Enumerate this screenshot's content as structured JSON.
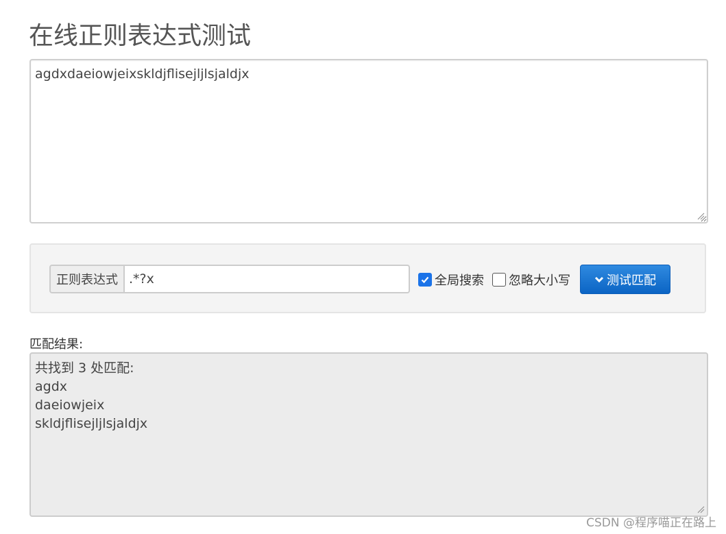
{
  "page": {
    "title": "在线正则表达式测试"
  },
  "source": {
    "text": "agdxdaeiowjeixskldjflisejljlsjaldjx"
  },
  "controls": {
    "regex_label": "正则表达式",
    "regex_value": ".*?x",
    "global_search": {
      "label": "全局搜索",
      "checked": true
    },
    "ignore_case": {
      "label": "忽略大小写",
      "checked": false
    },
    "test_button_label": "测试匹配",
    "test_button_icon": "chevron-down-icon",
    "accent_color": "#1b73e8"
  },
  "result": {
    "label": "匹配结果:",
    "summary": "共找到 3 处匹配:",
    "matches": [
      "agdx",
      "daeiowjeix",
      "skldjflisejljlsjaldjx"
    ]
  },
  "watermark": {
    "text": "CSDN @程序喵正在路上"
  }
}
